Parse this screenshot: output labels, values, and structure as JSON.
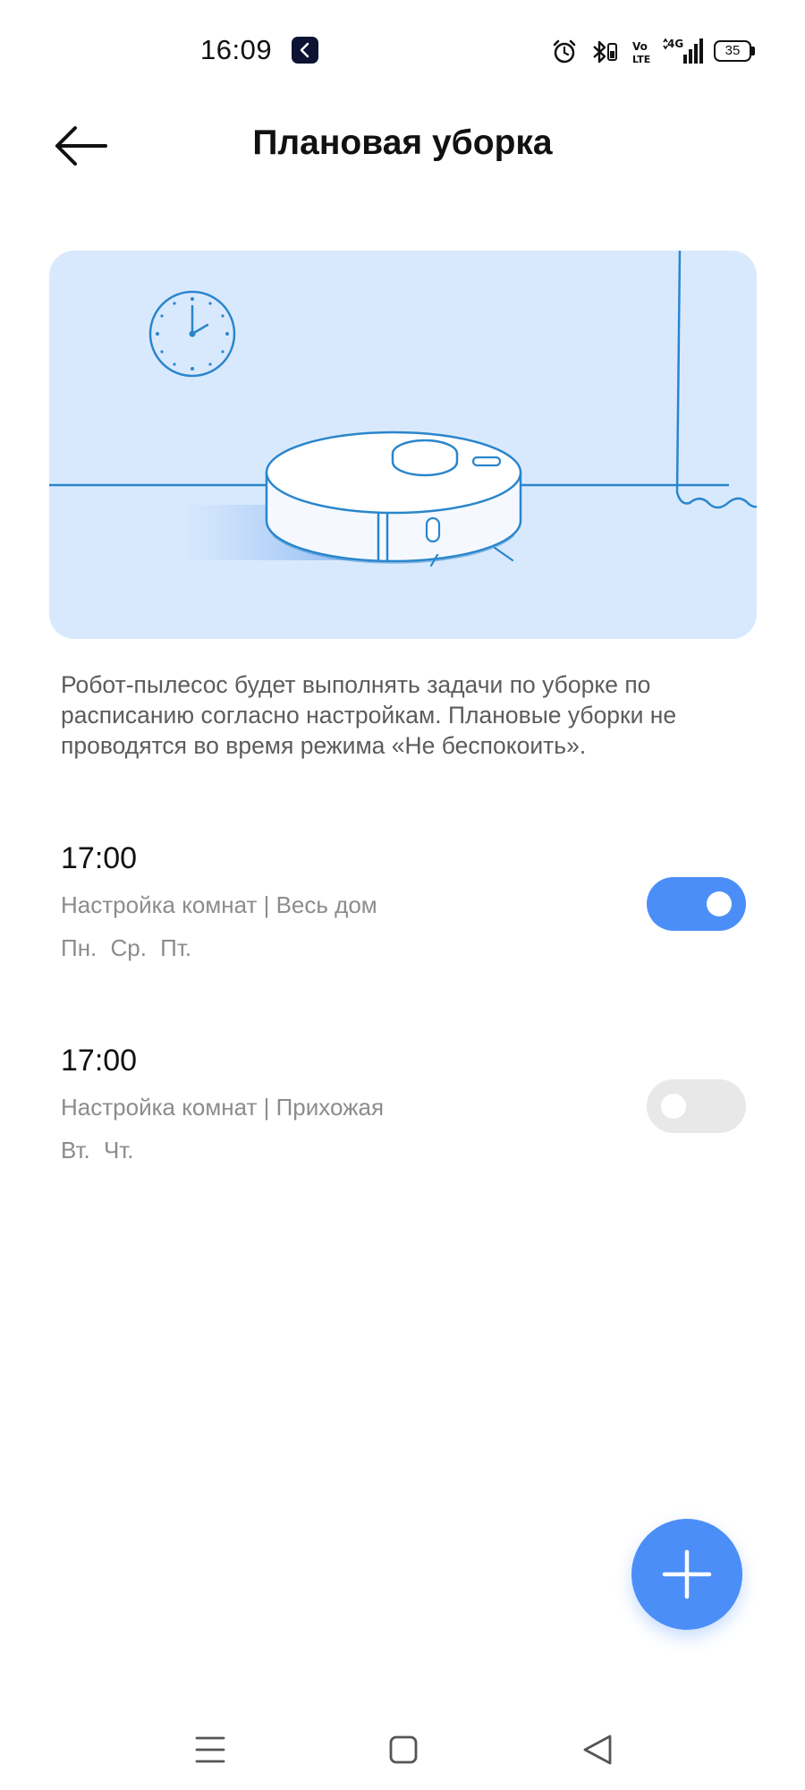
{
  "status_bar": {
    "time": "16:09",
    "battery": "35",
    "network": "4G"
  },
  "header": {
    "title": "Плановая уборка"
  },
  "description": "Робот-пылесос будет выполнять задачи по уборке по расписанию согласно настройкам. Плановые уборки не проводятся во время режима «Не беспокоить».",
  "schedules": [
    {
      "time": "17:00",
      "rooms": "Настройка комнат | Весь дом",
      "days": "Пн. Ср. Пт.",
      "enabled": true
    },
    {
      "time": "17:00",
      "rooms": "Настройка комнат | Прихожая",
      "days": "Вт. Чт.",
      "enabled": false
    }
  ],
  "icons": {
    "back": "arrow-left-icon",
    "add": "plus-icon",
    "nav_menu": "menu-icon",
    "nav_home": "home-square-icon",
    "nav_back": "triangle-back-icon"
  },
  "colors": {
    "accent": "#4b8ef8",
    "illustration_bg": "#d9e9fd",
    "toggle_off": "#e8e8e8"
  }
}
